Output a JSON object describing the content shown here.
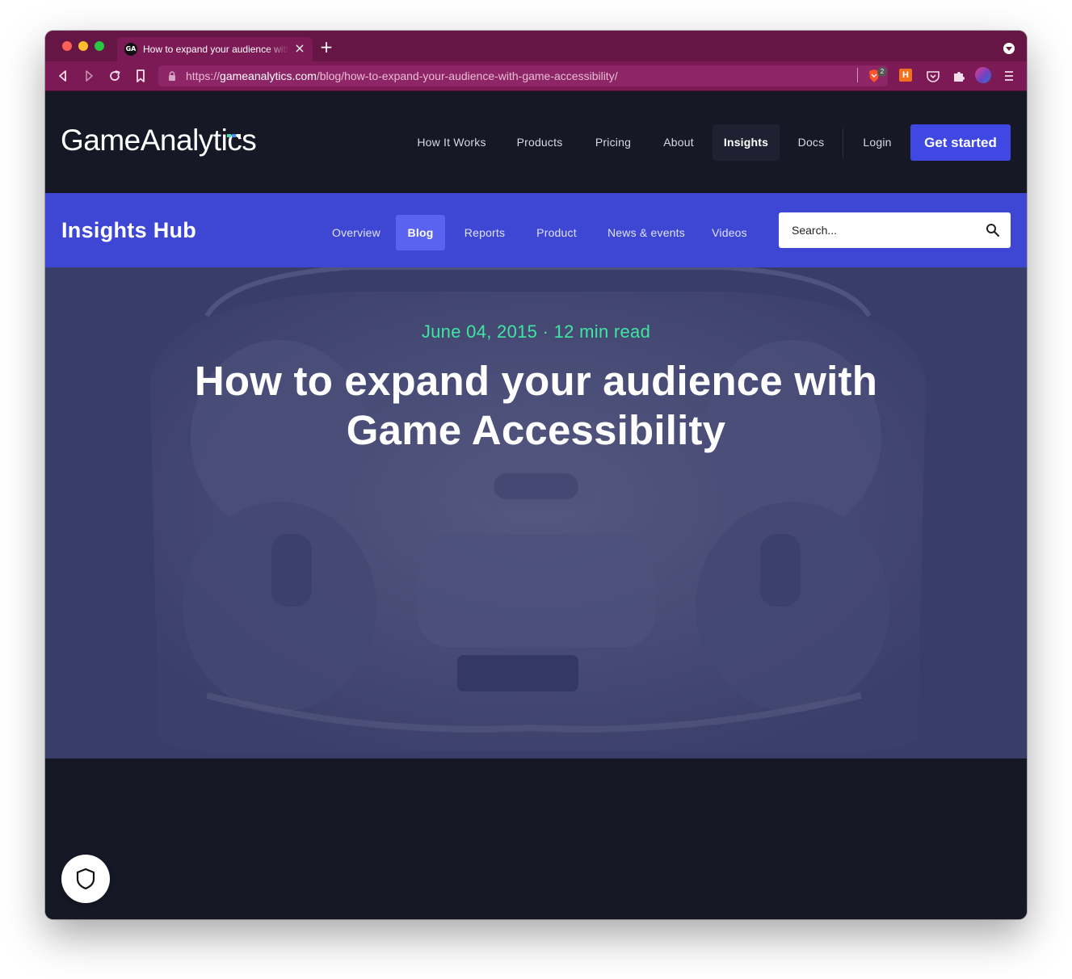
{
  "browser": {
    "tab_title": "How to expand your audience with Game Accessibility",
    "tab_close": "×",
    "new_tab": "+",
    "url_scheme": "https://",
    "url_host": "gameanalytics.com",
    "url_path": "/blog/how-to-expand-your-audience-with-game-accessibility/",
    "shields_count": "2",
    "extension_h": "H",
    "favicon_text": "GA"
  },
  "header": {
    "logo": "GameAnalytics",
    "logo_colors": [
      "#3ee6a0",
      "#4f8cff",
      "#ffffff"
    ],
    "nav": [
      {
        "label": "How It Works"
      },
      {
        "label": "Products"
      },
      {
        "label": "Pricing"
      },
      {
        "label": "About"
      },
      {
        "label": "Insights",
        "active": true
      },
      {
        "label": "Docs"
      },
      {
        "label": "Login"
      }
    ],
    "cta": "Get started"
  },
  "insights": {
    "title": "Insights Hub",
    "tabs": [
      {
        "label": "Overview"
      },
      {
        "label": "Blog",
        "active": true
      },
      {
        "label": "Reports"
      },
      {
        "label": "Product"
      },
      {
        "label": "News & events"
      },
      {
        "label": "Videos"
      }
    ],
    "search_placeholder": "Search..."
  },
  "hero": {
    "meta": "June 04, 2015 · 12 min read",
    "title": "How to expand your audience with Game Accessibility"
  },
  "colors": {
    "chrome": "#651645",
    "header_bg": "#161826",
    "insights_bg": "#3e47d3",
    "accent": "#3f48e2",
    "meta_green": "#3ee6a0"
  }
}
